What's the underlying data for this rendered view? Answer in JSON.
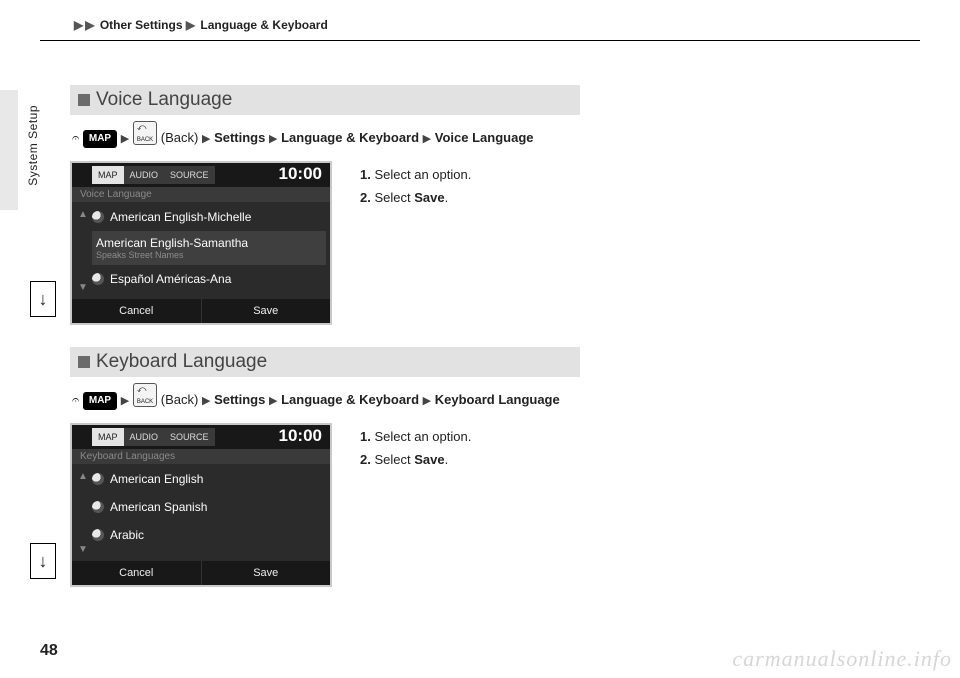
{
  "header": {
    "crumb1": "Other Settings",
    "crumb2": "Language & Keyboard"
  },
  "sidebar_label": "System Setup",
  "page_number": "48",
  "watermark": "carmanualsonline.info",
  "sections": [
    {
      "title": "Voice Language",
      "path": {
        "map": "MAP",
        "back_label": "BACK",
        "back_text": "(Back)",
        "p1": "Settings",
        "p2": "Language & Keyboard",
        "p3": "Voice Language"
      },
      "steps": [
        {
          "n": "1.",
          "text": "Select an option."
        },
        {
          "n": "2.",
          "text_pre": "Select ",
          "bold": "Save",
          "text_post": "."
        }
      ],
      "shot": {
        "tabs": [
          "MAP",
          "AUDIO",
          "SOURCE"
        ],
        "clock": "10:00",
        "subbar": "Voice Language",
        "items": [
          {
            "label": "American English-Michelle",
            "sub": ""
          },
          {
            "label": "American English-Samantha",
            "sub": "Speaks Street Names"
          },
          {
            "label": "Español Américas-Ana",
            "sub": ""
          }
        ],
        "cancel": "Cancel",
        "save": "Save"
      }
    },
    {
      "title": "Keyboard Language",
      "path": {
        "map": "MAP",
        "back_label": "BACK",
        "back_text": "(Back)",
        "p1": "Settings",
        "p2": "Language & Keyboard",
        "p3": "Keyboard Language"
      },
      "steps": [
        {
          "n": "1.",
          "text": "Select an option."
        },
        {
          "n": "2.",
          "text_pre": "Select ",
          "bold": "Save",
          "text_post": "."
        }
      ],
      "shot": {
        "tabs": [
          "MAP",
          "AUDIO",
          "SOURCE"
        ],
        "clock": "10:00",
        "subbar": "Keyboard Languages",
        "items": [
          {
            "label": "American English",
            "sub": ""
          },
          {
            "label": "American Spanish",
            "sub": ""
          },
          {
            "label": "Arabic",
            "sub": ""
          }
        ],
        "cancel": "Cancel",
        "save": "Save"
      }
    }
  ]
}
